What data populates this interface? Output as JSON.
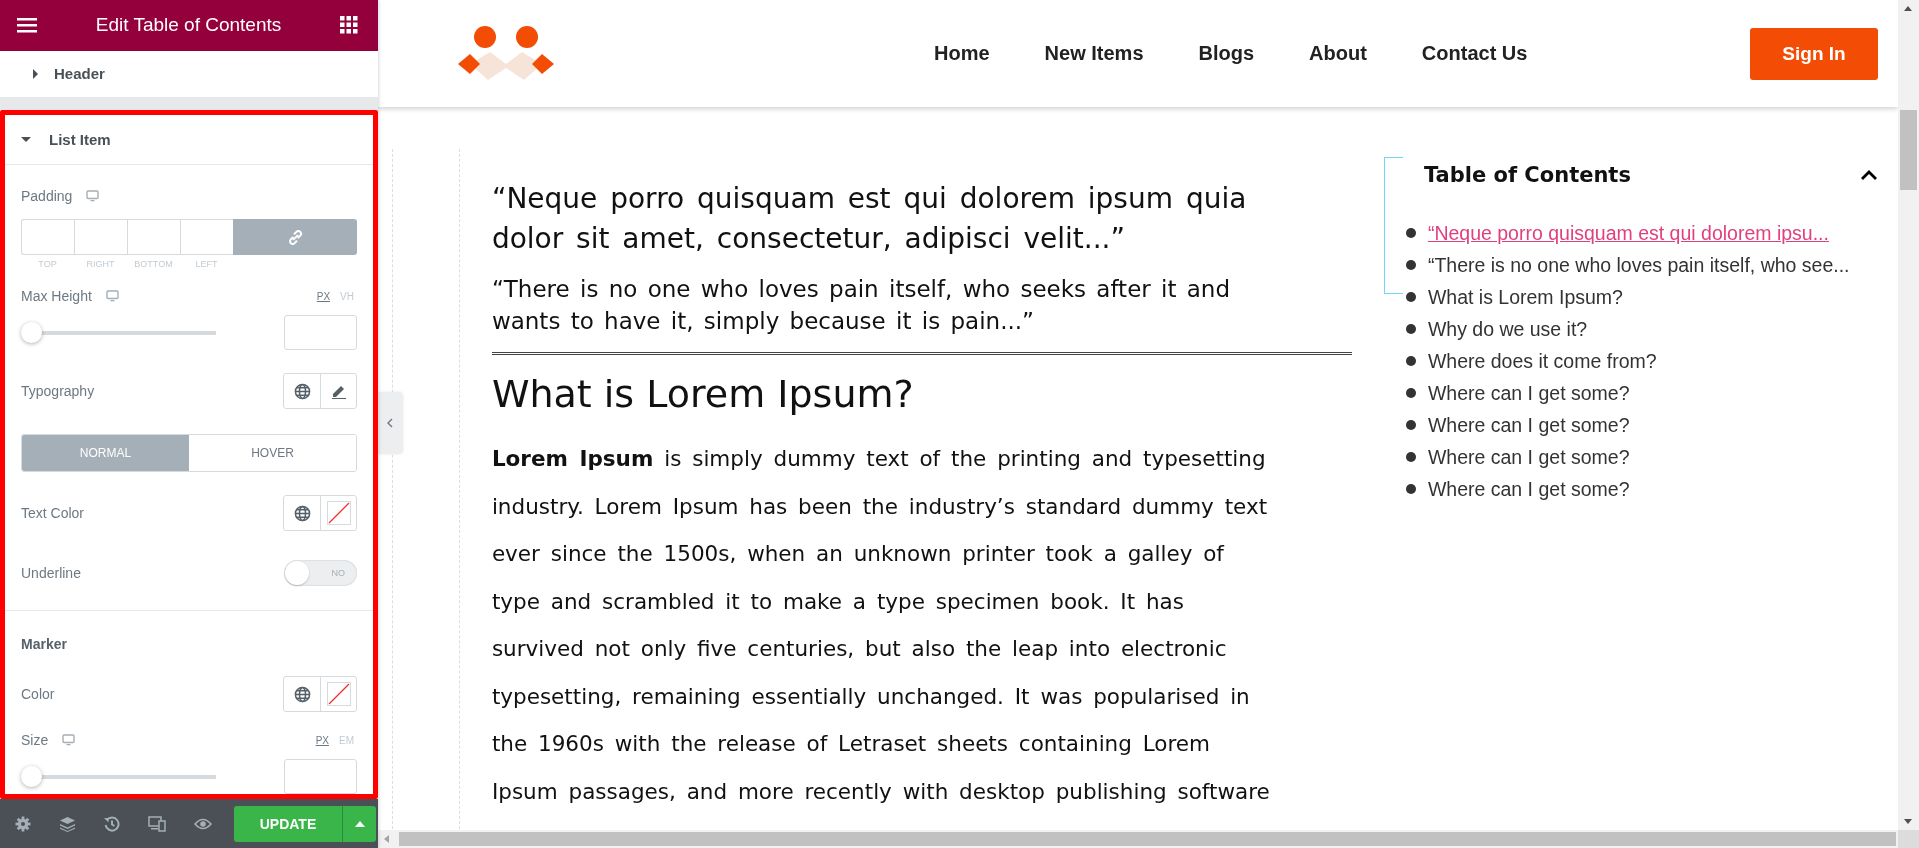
{
  "editor": {
    "title": "Edit Table of Contents",
    "sections": [
      {
        "label": "Header",
        "expanded": false,
        "highlighted": false
      },
      {
        "label": "List Item",
        "expanded": true,
        "highlighted": true
      }
    ],
    "controls": [
      {
        "kind": "dimensions",
        "label": "Padding",
        "responsive": true,
        "linked": true,
        "sides": [
          "TOP",
          "RIGHT",
          "BOTTOM",
          "LEFT"
        ]
      },
      {
        "kind": "slider",
        "label": "Max Height",
        "responsive": true,
        "units": [
          {
            "label": "PX",
            "selected": true
          },
          {
            "label": "VH",
            "selected": false
          }
        ],
        "level": 0
      },
      {
        "kind": "popover",
        "label": "Typography",
        "responsive": false
      },
      {
        "kind": "tabs",
        "tabs": [
          {
            "label": "NORMAL",
            "selected": true
          },
          {
            "label": "HOVER",
            "selected": false
          }
        ]
      },
      {
        "kind": "color",
        "label": "Text Color",
        "responsive": false
      },
      {
        "kind": "switch",
        "label": "Underline",
        "responsive": false,
        "on": false,
        "state_label": "NO"
      },
      {
        "kind": "heading",
        "label": "Marker"
      },
      {
        "kind": "color",
        "label": "Color",
        "responsive": false
      },
      {
        "kind": "slider",
        "label": "Size",
        "responsive": true,
        "units": [
          {
            "label": "PX",
            "selected": true
          },
          {
            "label": "EM",
            "selected": false
          }
        ],
        "level": 0
      }
    ],
    "update_button": "UPDATE"
  },
  "nav": {
    "links": [
      "Home",
      "New Items",
      "Blogs",
      "About",
      "Contact Us"
    ],
    "button": "Sign In"
  },
  "article": {
    "quotes": [
      {
        "lines": [
          "“Neque porro quisquam est qui dolorem ipsum quia",
          "dolor sit amet, consectetur, adipisci velit...”"
        ]
      },
      {
        "lines": [
          "“There is no one who loves pain itself, who seeks after it and",
          "wants to have it, simply because it is pain...”"
        ]
      }
    ],
    "heading": "What is Lorem Ipsum?",
    "paragraph_lines": [
      "**Lorem Ipsum** is simply dummy text of the printing and typesetting",
      "industry. Lorem Ipsum has been the industry’s standard dummy text",
      "ever since the 1500s, when an unknown printer took a galley of",
      "type and scrambled it to make a type specimen book. It has",
      "survived not only five centuries, but also the leap into electronic",
      "typesetting, remaining essentially unchanged. It was popularised in",
      "the 1960s with the release of Letraset sheets containing Lorem",
      "Ipsum passages, and more recently with desktop publishing software"
    ]
  },
  "toc": {
    "title": "Table of Contents",
    "expanded": true,
    "items": [
      {
        "label": "“Neque porro quisquam est qui dolorem ipsu...",
        "selected": true
      },
      {
        "label": "“There is no one who loves pain itself, who see...",
        "selected": false
      },
      {
        "label": "What is Lorem Ipsum?",
        "selected": false
      },
      {
        "label": "Why do we use it?",
        "selected": false
      },
      {
        "label": "Where does it come from?",
        "selected": false
      },
      {
        "label": "Where can I get some?",
        "selected": false
      },
      {
        "label": "Where can I get some?",
        "selected": false
      },
      {
        "label": "Where can I get some?",
        "selected": false
      },
      {
        "label": "Where can I get some?",
        "selected": false
      }
    ]
  }
}
